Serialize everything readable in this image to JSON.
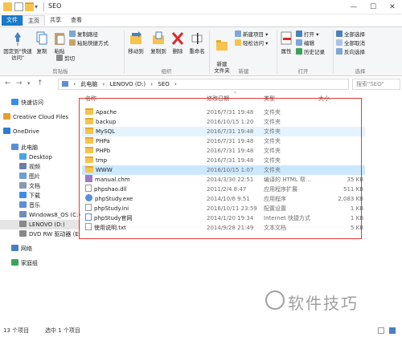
{
  "window": {
    "title": "SEO",
    "minimize": "—",
    "maximize": "☐",
    "close": "✕"
  },
  "ribbon_tabs": [
    "文件",
    "主页",
    "共享",
    "查看"
  ],
  "ribbon": {
    "pin_label": "固定到\"快速访问\"",
    "copy_label": "复制",
    "paste_label": "粘贴",
    "copy_path": "复制路径",
    "paste_shortcut": "粘贴快捷方式",
    "cut": "剪切",
    "clipboard_group": "剪贴板",
    "move_to": "移动到",
    "copy_to": "复制到",
    "delete": "删除",
    "rename": "重命名",
    "organize_group": "组织",
    "new_folder": "新建\n文件夹",
    "new_item": "新建项目",
    "easy_access": "轻松访问",
    "new_group": "新建",
    "properties": "属性",
    "open": "打开",
    "edit": "编辑",
    "history": "历史记录",
    "open_group": "打开",
    "select_all": "全部选择",
    "select_none": "全部取消",
    "invert_selection": "反向选择",
    "select_group": "选择"
  },
  "address": {
    "parts": [
      "此电脑",
      "›",
      "LENOVO (D:)",
      "›",
      "SEO",
      "›"
    ],
    "search_placeholder": "搜索\"SEO\""
  },
  "nav_pane": [
    {
      "label": "快速访问",
      "icon": "star-icon",
      "color": "#3a8ee6"
    },
    {
      "label": "Creative Cloud Files",
      "icon": "cloud-icon",
      "color": "#e0a030"
    },
    {
      "label": "OneDrive",
      "icon": "onedrive-icon",
      "color": "#2b7cd3"
    },
    {
      "label": "此电脑",
      "icon": "computer-icon",
      "color": "#5a8fd6"
    },
    {
      "label": "Desktop",
      "icon": "desktop-icon",
      "color": "#4aa3df"
    },
    {
      "label": "视频",
      "icon": "video-icon",
      "color": "#6a7fa8"
    },
    {
      "label": "图片",
      "icon": "pictures-icon",
      "color": "#6a9fd6"
    },
    {
      "label": "文档",
      "icon": "documents-icon",
      "color": "#8899aa"
    },
    {
      "label": "下载",
      "icon": "download-icon",
      "color": "#3a8ee6"
    },
    {
      "label": "音乐",
      "icon": "music-icon",
      "color": "#5a8fd6"
    },
    {
      "label": "Windows8_OS (C:)",
      "icon": "drive-c-icon",
      "color": "#6d8fb5"
    },
    {
      "label": "LENOVO (D:)",
      "icon": "drive-d-icon",
      "color": "#888888"
    },
    {
      "label": "DVD RW 驱动器 (E:",
      "icon": "dvd-icon",
      "color": "#888888"
    },
    {
      "label": "网络",
      "icon": "network-icon",
      "color": "#4a7fc0"
    },
    {
      "label": "家庭组",
      "icon": "homegroup-icon",
      "color": "#3aa35a"
    }
  ],
  "columns": {
    "name": "名称",
    "date": "修改日期",
    "type": "类型",
    "size": "大小"
  },
  "files": [
    {
      "name": "Apache",
      "date": "2016/7/31 19:48",
      "type": "文件夹",
      "size": "",
      "kind": "folder"
    },
    {
      "name": "backup",
      "date": "2016/10/15 1:20",
      "type": "文件夹",
      "size": "",
      "kind": "folder"
    },
    {
      "name": "MySQL",
      "date": "2016/7/31 19:48",
      "type": "文件夹",
      "size": "",
      "kind": "folder"
    },
    {
      "name": "PHPa",
      "date": "2016/7/31 19:48",
      "type": "文件夹",
      "size": "",
      "kind": "folder"
    },
    {
      "name": "PHPb",
      "date": "2016/7/31 19:48",
      "type": "文件夹",
      "size": "",
      "kind": "folder"
    },
    {
      "name": "tmp",
      "date": "2016/7/31 19:48",
      "type": "文件夹",
      "size": "",
      "kind": "folder"
    },
    {
      "name": "WWW",
      "date": "2016/10/15 1:07",
      "type": "文件夹",
      "size": "",
      "kind": "folder"
    },
    {
      "name": "manual.chm",
      "date": "2014/3/30 22:51",
      "type": "编译的 HTML 帮...",
      "size": "35 KB",
      "kind": "chm"
    },
    {
      "name": "phpshao.dll",
      "date": "2011/2/4 8:47",
      "type": "应用程序扩展",
      "size": "511 KB",
      "kind": "doc"
    },
    {
      "name": "phpStudy.exe",
      "date": "2014/10/6 9:51",
      "type": "应用程序",
      "size": "2,083 KB",
      "kind": "exe"
    },
    {
      "name": "phpStudy.ini",
      "date": "2016/10/11 23:59",
      "type": "配置设置",
      "size": "1 KB",
      "kind": "doc"
    },
    {
      "name": "phpStudy官网",
      "date": "2014/1/20 19:34",
      "type": "Internet 快捷方式",
      "size": "1 KB",
      "kind": "link"
    },
    {
      "name": "使用说明.txt",
      "date": "2014/9/28 21:49",
      "type": "文本文档",
      "size": "5 KB",
      "kind": "doc"
    }
  ],
  "status": {
    "count": "13 个项目",
    "selected": "选中 1 个项目"
  },
  "watermark": "软件技巧"
}
